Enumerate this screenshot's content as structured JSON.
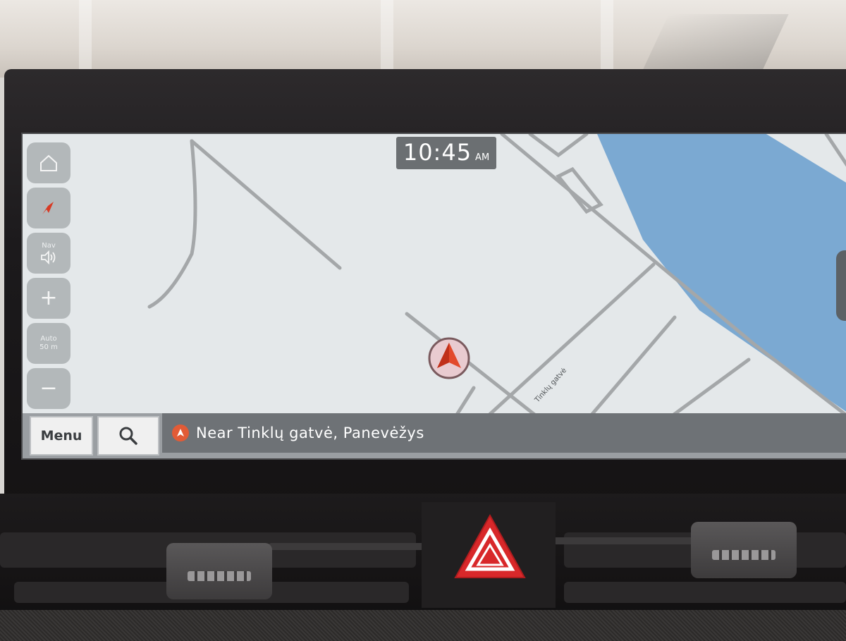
{
  "clock": {
    "time": "10:45",
    "ampm": "AM"
  },
  "map": {
    "street_label": "Tinklų gatvė",
    "colors": {
      "land": "#e4e8ea",
      "water": "#7ba9d2",
      "roads": "#a4a7a9",
      "vehicle": "#e24a2c"
    }
  },
  "controls": {
    "home_icon": "home-icon",
    "compass_icon": "compass-icon",
    "nav_label": "Nav",
    "nav_icon": "speaker-icon",
    "zoom_in_icon": "plus-icon",
    "scale_mode": "Auto",
    "scale_value": "50 m",
    "zoom_out_icon": "minus-icon"
  },
  "bottom": {
    "menu_label": "Menu",
    "search_icon": "search-icon",
    "location_text": "Near Tinklų gatvė, Panevėžys"
  }
}
